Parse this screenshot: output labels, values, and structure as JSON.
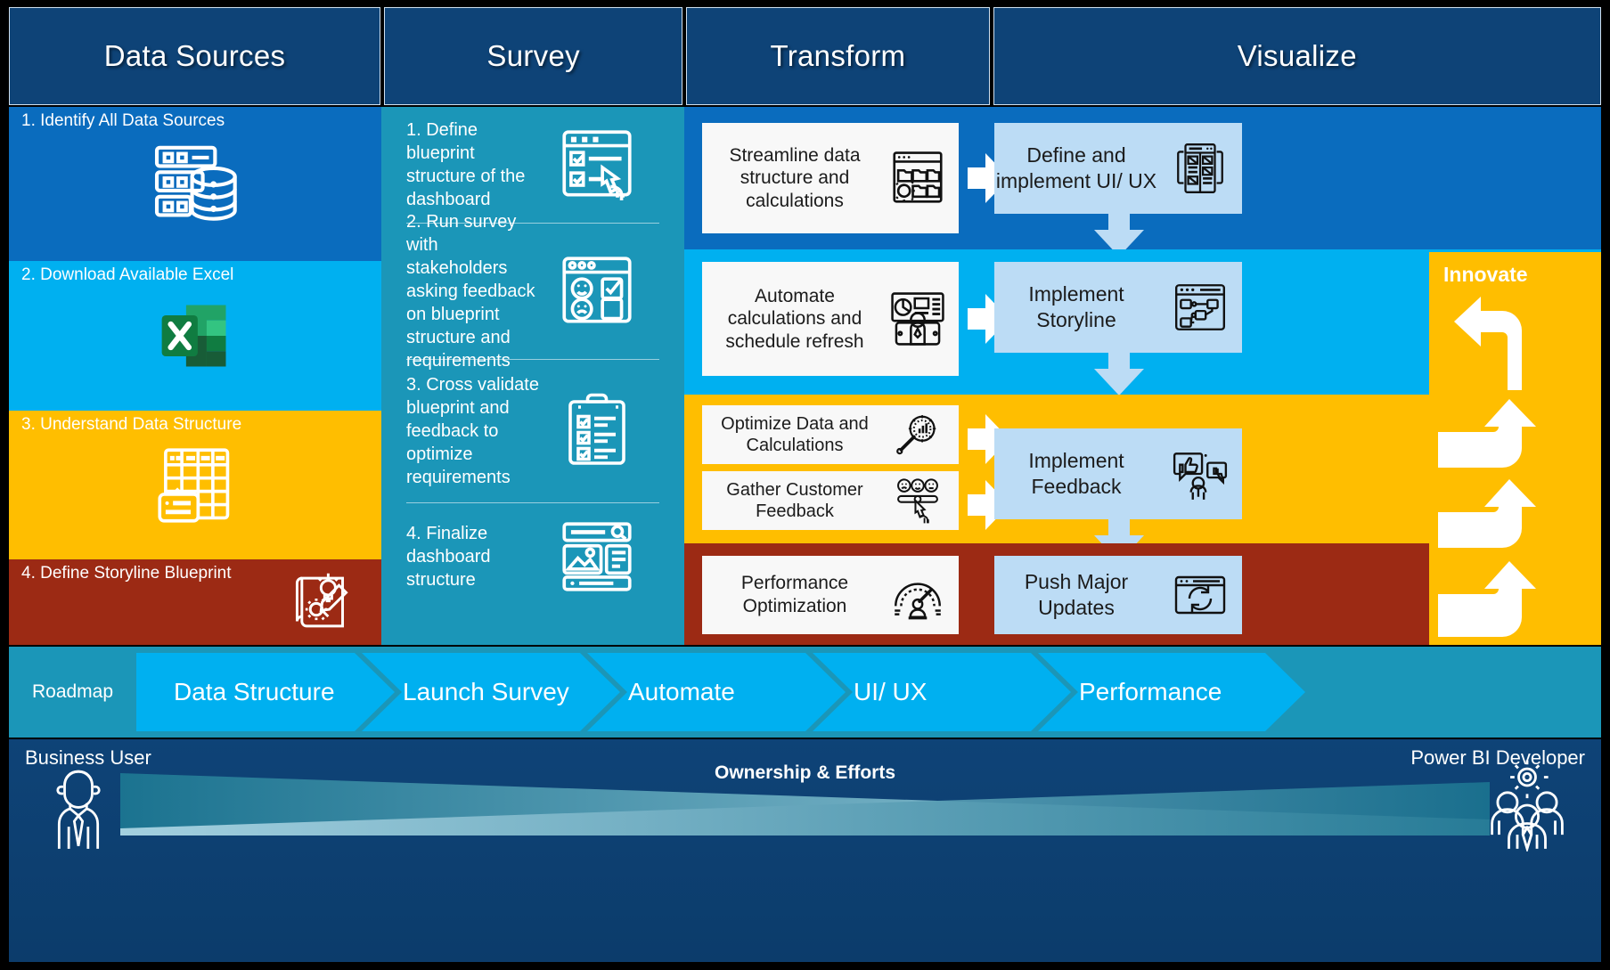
{
  "header": {
    "columns": [
      {
        "label": "Data Sources"
      },
      {
        "label": "Survey"
      },
      {
        "label": "Transform"
      },
      {
        "label": "Visualize"
      }
    ]
  },
  "colors": {
    "header_blue": "#0E4377",
    "row_dark_blue": "#0A6CBE",
    "row_light_blue": "#00B0F0",
    "row_amber": "#FFBE00",
    "row_red": "#9C2A14",
    "survey_teal": "#1B96B8",
    "card_white": "#F8F8F8",
    "card_lightblue": "#BCDCF5"
  },
  "data_sources": {
    "items": [
      {
        "label": "1. Identify All Data Sources",
        "icon": "database-server-icon"
      },
      {
        "label": "2. Download Available Excel",
        "icon": "excel-icon"
      },
      {
        "label": "3. Understand Data Structure",
        "icon": "spreadsheet-table-icon"
      },
      {
        "label": "4. Define Storyline Blueprint",
        "icon": "blueprint-idea-icon"
      }
    ]
  },
  "survey": {
    "items": [
      {
        "label": "1. Define blueprint structure of the dashboard",
        "icon": "checklist-click-icon"
      },
      {
        "label": "2. Run survey with stakeholders asking feedback on blueprint structure and requirements",
        "icon": "survey-smiley-icon"
      },
      {
        "label": "3. Cross validate blueprint and feedback to optimize requirements",
        "icon": "clipboard-check-icon"
      },
      {
        "label": "4. Finalize dashboard structure",
        "icon": "dashboard-layout-icon"
      }
    ]
  },
  "transform": {
    "cards": [
      {
        "label": "Streamline data structure and calculations",
        "icon": "folders-gear-icon"
      },
      {
        "label": "Automate calculations and schedule refresh",
        "icon": "dashboard-user-icon"
      },
      {
        "label": "Optimize Data and Calculations",
        "icon": "magnifier-gear-chart-icon"
      },
      {
        "label": "Gather Customer Feedback",
        "icon": "smiley-slider-click-icon"
      },
      {
        "label": "Performance Optimization",
        "icon": "speedometer-icon"
      }
    ]
  },
  "visualize": {
    "cards": [
      {
        "label": "Define and implement UI/ UX",
        "icon": "wireframe-icon"
      },
      {
        "label": "Implement Storyline",
        "icon": "flow-diagram-icon"
      },
      {
        "label": "Implement Feedback",
        "icon": "thumbs-feedback-icon"
      },
      {
        "label": "Push Major Updates",
        "icon": "refresh-window-icon"
      }
    ],
    "innovate": {
      "label": "Innovate",
      "loop_arrow_count": 4
    }
  },
  "roadmap": {
    "label": "Roadmap",
    "stages": [
      {
        "label": "Data Structure"
      },
      {
        "label": "Launch Survey"
      },
      {
        "label": "Automate"
      },
      {
        "label": "UI/ UX"
      },
      {
        "label": "Performance"
      }
    ]
  },
  "footer": {
    "left_label": "Business User",
    "right_label": "Power BI Developer",
    "center_label": "Ownership & Efforts",
    "left_icon": "business-user-icon",
    "right_icon": "developer-team-icon"
  }
}
